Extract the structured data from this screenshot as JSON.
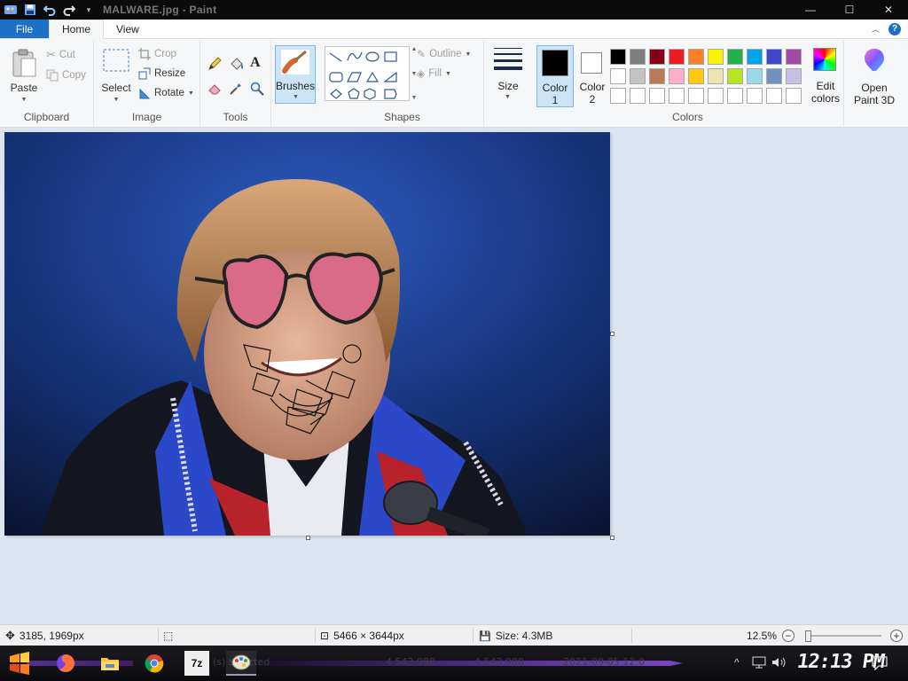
{
  "window": {
    "title": "MALWARE.jpg - Paint",
    "controls": {
      "minimize": "—",
      "maximize": "☐",
      "close": "✕"
    }
  },
  "tabs": [
    {
      "label": "File"
    },
    {
      "label": "Home"
    },
    {
      "label": "View"
    }
  ],
  "ribbon": {
    "clipboard": {
      "group_label": "Clipboard",
      "paste": "Paste",
      "cut": "Cut",
      "copy": "Copy"
    },
    "image": {
      "group_label": "Image",
      "select": "Select",
      "crop": "Crop",
      "resize": "Resize",
      "rotate": "Rotate"
    },
    "tools": {
      "group_label": "Tools",
      "brushes": "Brushes"
    },
    "shapes": {
      "group_label": "Shapes",
      "outline": "Outline",
      "fill": "Fill"
    },
    "size": {
      "label": "Size"
    },
    "colors": {
      "group_label": "Colors",
      "color1_label": "Color",
      "color1_num": "1",
      "color2_label": "Color",
      "color2_num": "2",
      "color1_value": "#000000",
      "color2_value": "#ffffff",
      "edit_colors_line1": "Edit",
      "edit_colors_line2": "colors",
      "palette": [
        "#000000",
        "#7f7f7f",
        "#880015",
        "#ed1c24",
        "#ff7f27",
        "#fff200",
        "#22b14c",
        "#00a2e8",
        "#3f48cc",
        "#a349a4",
        "#ffffff",
        "#c3c3c3",
        "#b97a57",
        "#ffaec9",
        "#ffc90e",
        "#efe4b0",
        "#b5e61d",
        "#99d9ea",
        "#7092be",
        "#c8bfe7",
        "#ffffff",
        "#ffffff",
        "#ffffff",
        "#ffffff",
        "#ffffff",
        "#ffffff",
        "#ffffff",
        "#ffffff",
        "#ffffff",
        "#ffffff"
      ]
    },
    "paint3d": {
      "line1": "Open",
      "line2": "Paint 3D"
    }
  },
  "status": {
    "cursor_position": "3185, 1969px",
    "image_dimensions": "5466 × 3644px",
    "file_size": "Size: 4.3MB",
    "zoom_level": "12.5%",
    "zoom_fraction": 0.03
  },
  "taskbar": {
    "clock": "12:13 PM",
    "ghost_left": "(s) selected",
    "ghost_size1": "4 543 988",
    "ghost_size2": "4 543 988",
    "ghost_date": "2021-09-05 12:0",
    "apps": [
      "firefox",
      "file-explorer",
      "chrome",
      "7-zip",
      "paint"
    ],
    "sevenzip_label": "7z"
  }
}
